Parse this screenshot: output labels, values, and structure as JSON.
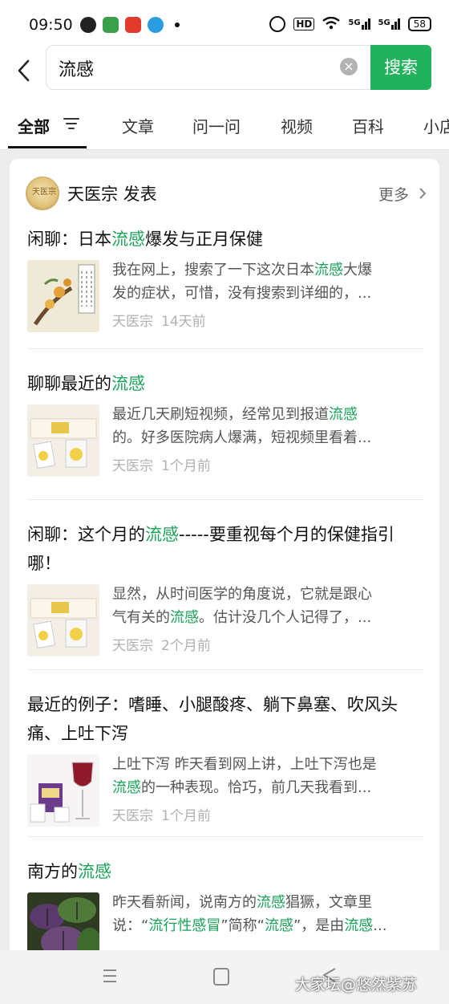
{
  "status_bar": {
    "time": "09:50",
    "hd": "HD",
    "signal1": "5G",
    "signal2": "5G",
    "battery": "58"
  },
  "search": {
    "query": "流感",
    "button_label": "搜索"
  },
  "tabs": [
    {
      "label": "全部",
      "active": true
    },
    {
      "label": "文章"
    },
    {
      "label": "问一问"
    },
    {
      "label": "视频"
    },
    {
      "label": "百科"
    },
    {
      "label": "小店"
    }
  ],
  "publisher": {
    "avatar_text": "天医宗",
    "label": "天医宗 发表",
    "more": "更多"
  },
  "articles": [
    {
      "title": [
        {
          "t": "闲聊：日本"
        },
        {
          "t": "流感",
          "hl": true
        },
        {
          "t": "爆发与正月保健"
        }
      ],
      "snippet1": [
        {
          "t": "我在网上，搜索了一下这次日本"
        },
        {
          "t": "流感",
          "hl": true
        },
        {
          "t": "大爆"
        }
      ],
      "snippet2": [
        {
          "t": "发的症状，可惜，没有搜索到详细的，..."
        }
      ],
      "source": "天医宗",
      "time": "14天前",
      "thumb": "book"
    },
    {
      "title": [
        {
          "t": "聊聊最近的"
        },
        {
          "t": "流感",
          "hl": true
        }
      ],
      "snippet1": [
        {
          "t": "最近几天刷短视频，经常见到报道"
        },
        {
          "t": "流感",
          "hl": true
        }
      ],
      "snippet2": [
        {
          "t": "的。好多医院病人爆满，短视频里看着..."
        }
      ],
      "source": "天医宗",
      "time": "1个月前",
      "thumb": "box"
    },
    {
      "title": [
        {
          "t": "闲聊：这个月的"
        },
        {
          "t": "流感",
          "hl": true
        },
        {
          "t": "-----要重视每个月的保健指引哪！"
        }
      ],
      "snippet1": [
        {
          "t": "显然，从时间医学的角度说，它就是跟心"
        }
      ],
      "snippet2": [
        {
          "t": "气有关的"
        },
        {
          "t": "流感",
          "hl": true
        },
        {
          "t": "。估计没几个人记得了，..."
        }
      ],
      "source": "天医宗",
      "time": "2个月前",
      "thumb": "box"
    },
    {
      "title": [
        {
          "t": "最近的例子：嗜睡、小腿酸疼、躺下鼻塞、吹风头痛、上吐下泻"
        }
      ],
      "snippet1": [
        {
          "t": "上吐下泻 昨天看到网上讲，上吐下泻也是"
        }
      ],
      "snippet2": [
        {
          "t": "流感",
          "hl": true
        },
        {
          "t": "的一种表现。恰巧，前几天我看到..."
        }
      ],
      "source": "天医宗",
      "time": "1个月前",
      "thumb": "wine"
    },
    {
      "title": [
        {
          "t": "南方的"
        },
        {
          "t": "流感",
          "hl": true
        }
      ],
      "snippet1": [
        {
          "t": "昨天看新闻，说南方的"
        },
        {
          "t": "流感",
          "hl": true
        },
        {
          "t": "猖獗，文章里"
        }
      ],
      "snippet2": [
        {
          "t": "说：“"
        },
        {
          "t": "流行性感冒",
          "hl": true
        },
        {
          "t": "”简称“"
        },
        {
          "t": "流感",
          "hl": true
        },
        {
          "t": "”，是由"
        },
        {
          "t": "流感",
          "hl": true
        },
        {
          "t": "..."
        }
      ],
      "source": "",
      "time": "",
      "thumb": "leaf"
    }
  ],
  "watermark": "大家坛@悠然紫苏",
  "colors": {
    "accent": "#22b25d",
    "highlight": "#1aa358"
  }
}
